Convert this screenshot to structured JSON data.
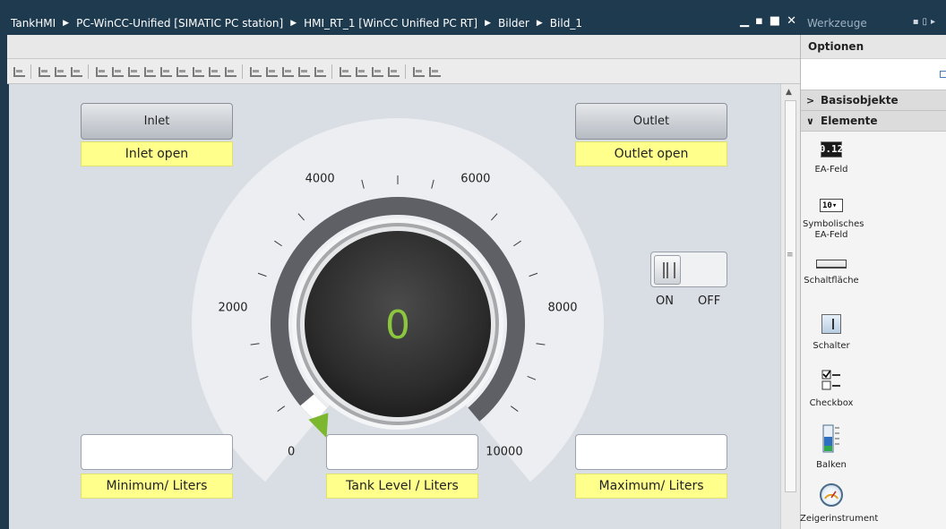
{
  "breadcrumb": [
    "TankHMI",
    "PC-WinCC-Unified [SIMATIC PC station]",
    "HMI_RT_1 [WinCC Unified PC RT]",
    "Bilder",
    "Bild_1"
  ],
  "window_controls": {
    "minimize": "▁",
    "restore": "▪",
    "maximize": "■",
    "close": "✕"
  },
  "hmi": {
    "inlet_button": "Inlet",
    "inlet_status": "Inlet open",
    "outlet_button": "Outlet",
    "outlet_status": "Outlet open",
    "minimum_label": "Minimum/ Liters",
    "tank_level_label": "Tank Level / Liters",
    "maximum_label": "Maximum/ Liters",
    "toggle_on": "ON",
    "toggle_off": "OFF"
  },
  "gauge": {
    "value": "0",
    "min": 0,
    "max": 10000,
    "labels": [
      "0",
      "2000",
      "4000",
      "6000",
      "8000",
      "10000"
    ],
    "value_color": "#8cc63f",
    "pointer_color": "#7cb82f"
  },
  "tools_panel": {
    "title": "Werkzeuge",
    "options": "Optionen",
    "sections": [
      {
        "label": "Basisobjekte",
        "expanded": false
      },
      {
        "label": "Elemente",
        "expanded": true
      }
    ],
    "elements": [
      {
        "label": "EA-Feld",
        "glyph": "0.12"
      },
      {
        "label": "Symbolisches EA-Feld",
        "glyph": "10▾"
      },
      {
        "label": "Schaltfläche"
      },
      {
        "label": "Schalter"
      },
      {
        "label": "Checkbox"
      },
      {
        "label": "Balken"
      },
      {
        "label": "Zeigerinstrument"
      }
    ]
  },
  "colors": {
    "titlebar": "#1e3a4f",
    "label_yellow": "#ffff8c",
    "canvas": "#d9dde4"
  }
}
